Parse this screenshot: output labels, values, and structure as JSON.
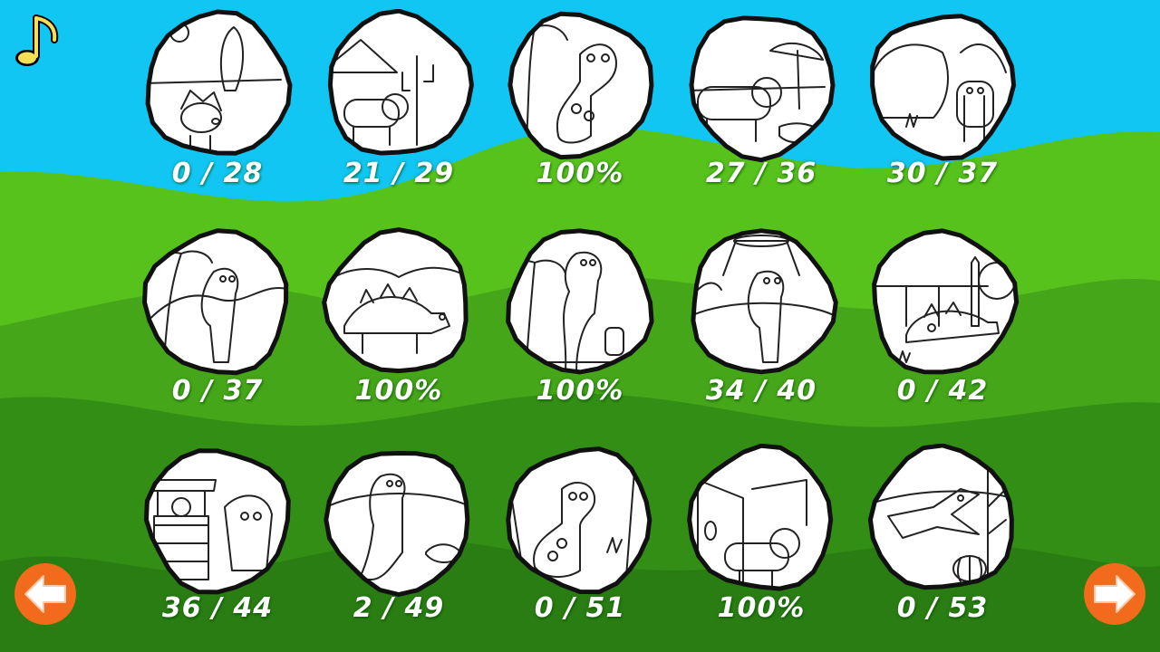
{
  "theme": {
    "sky": "#11c6f2",
    "hill_back": "#58c21c",
    "hill_mid": "#45a418",
    "hill_front": "#2f8a14",
    "nav_button": "#f26a1b",
    "music_note": "#f4df55"
  },
  "music_button": {
    "icon": "music-note-icon"
  },
  "nav": {
    "prev": {
      "icon": "arrow-left-icon"
    },
    "next": {
      "icon": "arrow-right-icon"
    }
  },
  "pages": [
    {
      "scene": "triceratops-rocket",
      "progress": "0 / 28"
    },
    {
      "scene": "triceratops-pyramid-cactus",
      "progress": "21 / 29"
    },
    {
      "scene": "brachiosaurus-palm",
      "progress": "100%"
    },
    {
      "scene": "triceratops-umbrella-beach",
      "progress": "27 / 36"
    },
    {
      "scene": "dino-cave",
      "progress": "30 / 37"
    },
    {
      "scene": "dino-palm-hills",
      "progress": "0 / 37"
    },
    {
      "scene": "stegosaurus-hills",
      "progress": "100%"
    },
    {
      "scene": "dino-palm-desert",
      "progress": "100%"
    },
    {
      "scene": "dino-volcano",
      "progress": "34 / 40"
    },
    {
      "scene": "stegosaurus-fence",
      "progress": "0 / 42"
    },
    {
      "scene": "dino-well",
      "progress": "36 / 44"
    },
    {
      "scene": "dino-rocks",
      "progress": "2 / 49"
    },
    {
      "scene": "brachiosaurus-jungle",
      "progress": "0 / 51"
    },
    {
      "scene": "triceratops-house",
      "progress": "100%"
    },
    {
      "scene": "pterodactyl-pumpkin",
      "progress": "0 / 53"
    }
  ]
}
